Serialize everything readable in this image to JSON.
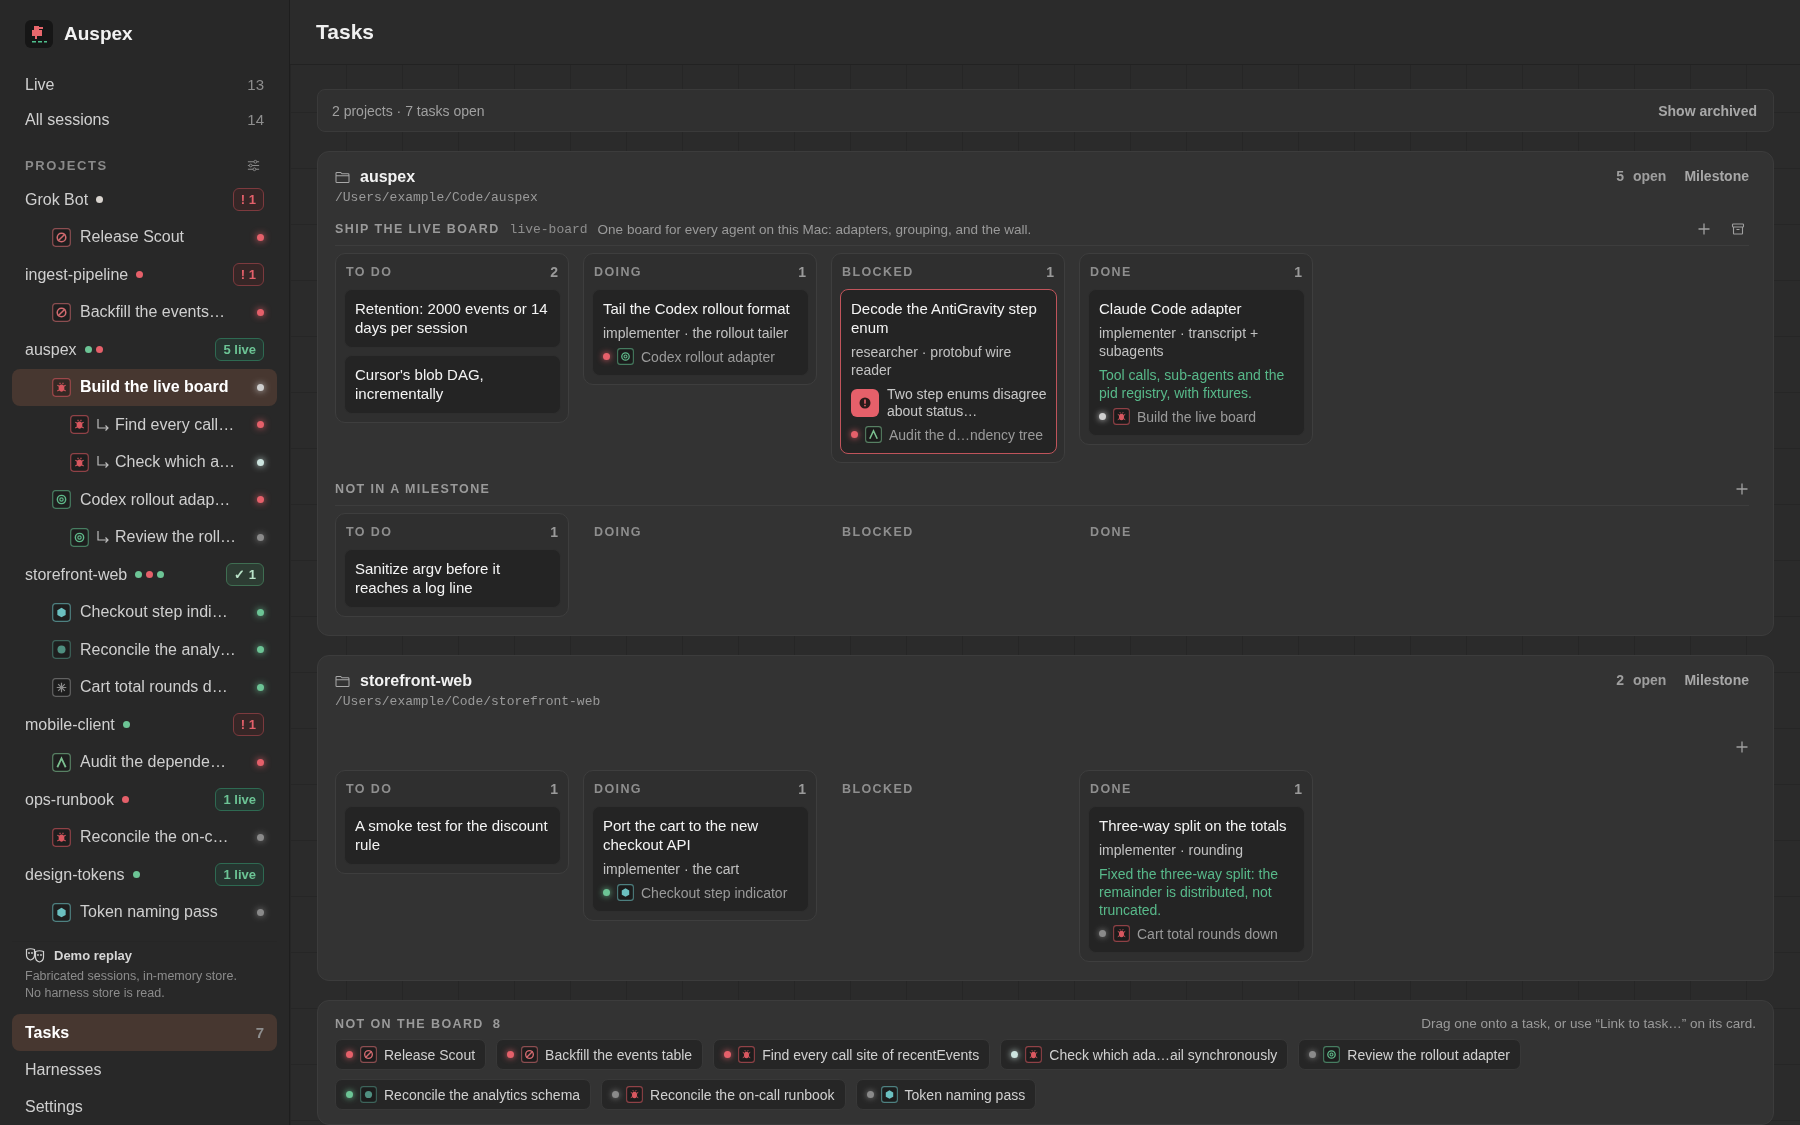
{
  "app": {
    "name": "Auspex"
  },
  "nav": [
    {
      "label": "Live",
      "count": "13",
      "selected": false
    },
    {
      "label": "All sessions",
      "count": "14",
      "selected": false
    }
  ],
  "projects_header": {
    "label": "PROJECTS"
  },
  "projects": [
    {
      "name": "Grok Bot",
      "dots": [
        {
          "color": "#d9d4cf"
        }
      ],
      "badge": {
        "kind": "alert",
        "text": "! 1"
      },
      "sessions": [
        {
          "title": "Release Scout",
          "agent": {
            "kind": "loop"
          },
          "color": "#e5606a",
          "selected": false
        }
      ]
    },
    {
      "name": "ingest-pipeline",
      "dots": [
        {
          "color": "#e5606a"
        }
      ],
      "badge": {
        "kind": "alert",
        "text": "! 1"
      },
      "sessions": [
        {
          "title": "Backfill the events…",
          "agent": {
            "kind": "loop"
          },
          "color": "#e5606a",
          "selected": false
        }
      ]
    },
    {
      "name": "auspex",
      "dots": [
        {
          "color": "#6cc495"
        },
        {
          "color": "#e5606a"
        }
      ],
      "badge": {
        "kind": "live",
        "text": "5 live"
      },
      "sessions": [
        {
          "title": "Build the live board",
          "agent": {
            "kind": "bug"
          },
          "color": "#cfcfcf",
          "selected": true,
          "children": [
            {
              "title": "Find every call…",
              "agent": {
                "kind": "bug"
              },
              "color": "#e5606a",
              "selected": false
            },
            {
              "title": "Check which a…",
              "agent": {
                "kind": "bug"
              },
              "color": "#cde4df",
              "selected": false
            }
          ]
        },
        {
          "title": "Codex rollout adap…",
          "agent": {
            "kind": "knot"
          },
          "color": "#e5606a",
          "selected": false,
          "children": [
            {
              "title": "Review the roll…",
              "agent": {
                "kind": "knot"
              },
              "color": "#8a8a8a",
              "selected": false
            }
          ]
        }
      ]
    },
    {
      "name": "storefront-web",
      "dots": [
        {
          "color": "#6cc495"
        },
        {
          "color": "#e5606a"
        },
        {
          "color": "#6cc495"
        }
      ],
      "badge": {
        "kind": "done",
        "text": "✓ 1"
      },
      "sessions": [
        {
          "title": "Checkout step indi…",
          "agent": {
            "kind": "cube"
          },
          "color": "#6cc495",
          "selected": false
        },
        {
          "title": "Reconcile the analy…",
          "agent": {
            "kind": "gear"
          },
          "color": "#6cc495",
          "selected": false
        },
        {
          "title": "Cart total rounds d…",
          "agent": {
            "kind": "spark"
          },
          "color": "#6cc495",
          "selected": false
        }
      ]
    },
    {
      "name": "mobile-client",
      "dots": [
        {
          "color": "#6cc495"
        }
      ],
      "badge": {
        "kind": "alert",
        "text": "! 1"
      },
      "sessions": [
        {
          "title": "Audit the depende…",
          "agent": {
            "kind": "peak"
          },
          "color": "#e5606a",
          "selected": false
        }
      ]
    },
    {
      "name": "ops-runbook",
      "dots": [
        {
          "color": "#e5606a"
        }
      ],
      "badge": {
        "kind": "live",
        "text": "1 live"
      },
      "sessions": [
        {
          "title": "Reconcile the on-c…",
          "agent": {
            "kind": "bug"
          },
          "color": "#8a8a8a",
          "selected": false
        }
      ]
    },
    {
      "name": "design-tokens",
      "dots": [
        {
          "color": "#6cc495"
        }
      ],
      "badge": {
        "kind": "live",
        "text": "1 live"
      },
      "sessions": [
        {
          "title": "Token naming pass",
          "agent": {
            "kind": "cube"
          },
          "color": "#8a8a8a",
          "selected": false
        }
      ]
    }
  ],
  "demo": {
    "title": "Demo replay",
    "lines": [
      "Fabricated sessions, in-memory store.",
      "No harness store is read."
    ]
  },
  "bottom_nav": [
    {
      "label": "Tasks",
      "count": "7",
      "selected": true
    },
    {
      "label": "Harnesses",
      "selected": false
    },
    {
      "label": "Settings",
      "selected": false
    }
  ],
  "page": {
    "title": "Tasks"
  },
  "summary": {
    "text": "2 projects · 7 tasks open",
    "action": "Show archived"
  },
  "boards": [
    {
      "name": "auspex",
      "path": "/Users/example/Code/auspex",
      "open_count": "5",
      "open_label": "open",
      "action": "Milestone",
      "groups": [
        {
          "kind": "milestone",
          "title": "SHIP THE LIVE BOARD",
          "slug": "live-board",
          "description": "One board for every agent on this Mac: adapters, grouping, and the wall.",
          "columns": [
            {
              "name": "TO DO",
              "count": "2",
              "cards": [
                {
                  "title": "Retention: 2000 events or 14 days per session",
                  "blocked": false
                },
                {
                  "title": "Cursor's blob DAG, incrementally",
                  "blocked": false
                }
              ]
            },
            {
              "name": "DOING",
              "count": "1",
              "cards": [
                {
                  "title": "Tail the Codex rollout format",
                  "meta": "implementer · the rollout tailer",
                  "blocked": false,
                  "link": {
                    "color": "#e5606a",
                    "agent": {
                      "kind": "knot"
                    },
                    "text": "Codex rollout adapter"
                  }
                }
              ]
            },
            {
              "name": "BLOCKED",
              "count": "1",
              "cards": [
                {
                  "title": "Decode the AntiGravity step enum",
                  "meta": "researcher · protobuf wire reader",
                  "blocked": true,
                  "alert": "Two step enums disagree about status…",
                  "link": {
                    "color": "#e5606a",
                    "agent": {
                      "kind": "peak"
                    },
                    "text": "Audit the d…ndency tree"
                  }
                }
              ]
            },
            {
              "name": "DONE",
              "count": "1",
              "cards": [
                {
                  "title": "Claude Code adapter",
                  "meta": "implementer · transcript + subagents",
                  "note": "Tool calls, sub-agents and the pid registry, with fixtures.",
                  "blocked": false,
                  "link": {
                    "color": "#cfcfcf",
                    "agent": {
                      "kind": "bug"
                    },
                    "text": "Build the live board"
                  }
                }
              ]
            }
          ]
        },
        {
          "kind": "unassigned",
          "title": "NOT IN A MILESTONE",
          "columns": [
            {
              "name": "TO DO",
              "count": "1",
              "cards": [
                {
                  "title": "Sanitize argv before it reaches a log line",
                  "blocked": false
                }
              ]
            },
            {
              "name": "DOING"
            },
            {
              "name": "BLOCKED"
            },
            {
              "name": "DONE"
            }
          ]
        }
      ]
    },
    {
      "name": "storefront-web",
      "path": "/Users/example/Code/storefront-web",
      "open_count": "2",
      "open_label": "open",
      "action": "Milestone",
      "groups": [
        {
          "kind": "plain",
          "columns": [
            {
              "name": "TO DO",
              "count": "1",
              "cards": [
                {
                  "title": "A smoke test for the discount rule",
                  "blocked": false
                }
              ]
            },
            {
              "name": "DOING",
              "count": "1",
              "cards": [
                {
                  "title": "Port the cart to the new checkout API",
                  "meta": "implementer · the cart",
                  "blocked": false,
                  "link": {
                    "color": "#6cc495",
                    "agent": {
                      "kind": "cube"
                    },
                    "text": "Checkout step indicator"
                  }
                }
              ]
            },
            {
              "name": "BLOCKED"
            },
            {
              "name": "DONE",
              "count": "1",
              "cards": [
                {
                  "title": "Three-way split on the totals",
                  "meta": "implementer · rounding",
                  "note": "Fixed the three-way split: the remainder is distributed, not truncated.",
                  "blocked": false,
                  "link": {
                    "color": "#8a8a8a",
                    "agent": {
                      "kind": "bug"
                    },
                    "text": "Cart total rounds down"
                  }
                }
              ]
            }
          ]
        }
      ]
    }
  ],
  "unlinked": {
    "title": "NOT ON THE BOARD",
    "count": "8",
    "hint": "Drag one onto a task, or use “Link to task…” on its card.",
    "chips": [
      {
        "color": "#e5606a",
        "agent": {
          "kind": "loop"
        },
        "text": "Release Scout"
      },
      {
        "color": "#e5606a",
        "agent": {
          "kind": "loop"
        },
        "text": "Backfill the events table"
      },
      {
        "color": "#e5606a",
        "agent": {
          "kind": "bug"
        },
        "text": "Find every call site of recentEvents"
      },
      {
        "color": "#cde4df",
        "agent": {
          "kind": "bug"
        },
        "text": "Check which ada…ail synchronously"
      },
      {
        "color": "#8a8a8a",
        "agent": {
          "kind": "knot"
        },
        "text": "Review the rollout adapter"
      },
      {
        "color": "#6cc495",
        "agent": {
          "kind": "gear"
        },
        "text": "Reconcile the analytics schema"
      },
      {
        "color": "#8a8a8a",
        "agent": {
          "kind": "bug"
        },
        "text": "Reconcile the on-call runbook"
      },
      {
        "color": "#8a8a8a",
        "agent": {
          "kind": "cube"
        },
        "text": "Token naming pass"
      }
    ]
  }
}
